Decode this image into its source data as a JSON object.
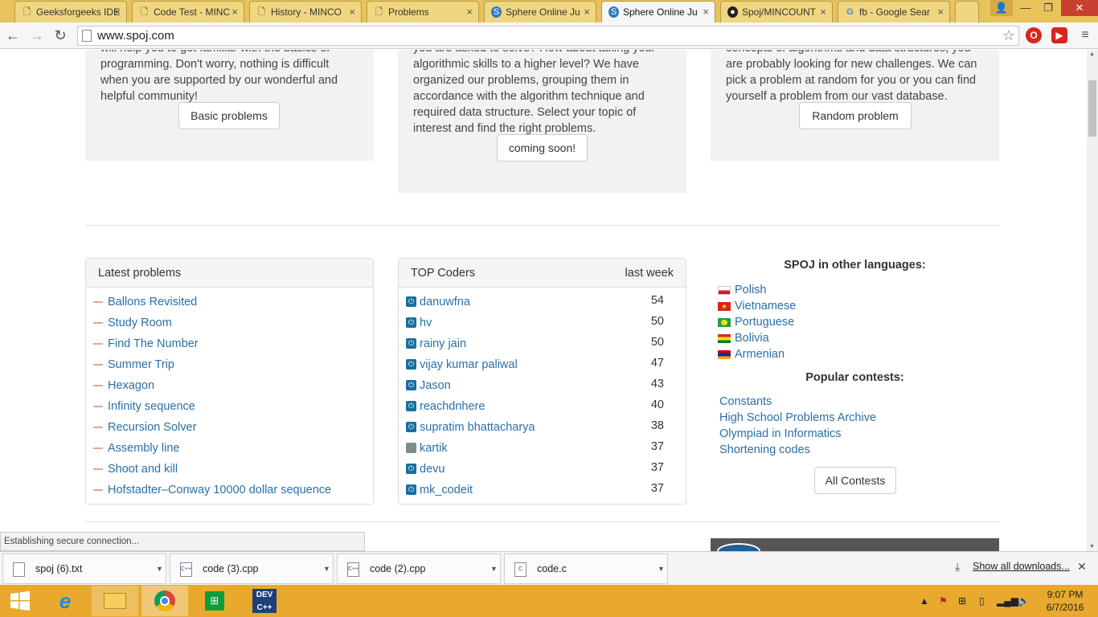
{
  "browser": {
    "tabs": [
      {
        "title": "Geeksforgeeks IDE",
        "icon": "page-icon",
        "active": false
      },
      {
        "title": "Code Test - MINC",
        "icon": "page-icon",
        "active": false
      },
      {
        "title": "History - MINCO",
        "icon": "page-icon",
        "active": false
      },
      {
        "title": "Problems",
        "icon": "page-icon",
        "active": false
      },
      {
        "title": "Sphere Online Ju",
        "icon": "spoj-icon",
        "active": false
      },
      {
        "title": "Sphere Online Ju",
        "icon": "spoj-icon",
        "active": true
      },
      {
        "title": "Spoj/MINCOUNT",
        "icon": "github-icon",
        "active": false
      },
      {
        "title": "fb - Google Sear",
        "icon": "google-icon",
        "active": false
      }
    ],
    "url": "www.spoj.com",
    "status": "Establishing secure connection..."
  },
  "features": [
    {
      "text": "will help you to get familiar with the basics of programming. Don't worry, nothing is difficult when you are supported by our wonderful and helpful community!",
      "button": "Basic problems"
    },
    {
      "text": "you are asked to solve? How about taking your algorithmic skills to a higher level? We have organized our problems, grouping them in accordance with the algorithm technique and required data structure. Select your topic of interest and find the right problems.",
      "button": "coming soon!"
    },
    {
      "text": "concepts of algorithms and data structures, you are probably looking for new challenges. We can pick a problem at random for you or you can find yourself a problem from our vast database.",
      "button": "Random problem"
    }
  ],
  "latest_problems": {
    "heading": "Latest problems",
    "items": [
      "Ballons Revisited",
      "Study Room",
      "Find The Number",
      "Summer Trip",
      "Hexagon",
      "Infinity sequence",
      "Recursion Solver",
      "Assembly line",
      "Shoot and kill",
      "Hofstadter–Conway 10000 dollar sequence"
    ]
  },
  "top_coders": {
    "heading": "TOP Coders",
    "period": "last week",
    "rows": [
      {
        "name": "danuwfna",
        "score": "54",
        "icon": "power-icon"
      },
      {
        "name": "hv",
        "score": "50",
        "icon": "power-icon"
      },
      {
        "name": "rainy jain",
        "score": "50",
        "icon": "power-icon"
      },
      {
        "name": "vijay kumar paliwal",
        "score": "47",
        "icon": "power-icon"
      },
      {
        "name": "Jason",
        "score": "43",
        "icon": "power-icon"
      },
      {
        "name": "reachdnhere",
        "score": "40",
        "icon": "power-icon"
      },
      {
        "name": "supratim bhattacharya",
        "score": "38",
        "icon": "power-icon"
      },
      {
        "name": "kartik",
        "score": "37",
        "icon": "avatar-photo"
      },
      {
        "name": "devu",
        "score": "37",
        "icon": "power-icon"
      },
      {
        "name": "mk_codeit",
        "score": "37",
        "icon": "power-icon"
      }
    ]
  },
  "languages": {
    "heading": "SPOJ in other languages:",
    "items": [
      {
        "label": "Polish",
        "flag": "poland-flag"
      },
      {
        "label": "Vietnamese",
        "flag": "vietnam-flag"
      },
      {
        "label": "Portuguese",
        "flag": "brazil-flag"
      },
      {
        "label": "Bolivia",
        "flag": "bolivia-flag"
      },
      {
        "label": "Armenian",
        "flag": "armenia-flag"
      }
    ]
  },
  "contests": {
    "heading": "Popular contests:",
    "items": [
      "Constants",
      "High School Problems Archive",
      "Olympiad in Informatics",
      "Shortening codes"
    ],
    "button": "All Contests"
  },
  "downloads": {
    "items": [
      "spoj (6).txt",
      "code (3).cpp",
      "code (2).cpp",
      "code.c"
    ],
    "show_all": "Show all downloads..."
  },
  "taskbar": {
    "time": "9:07 PM",
    "date": "6/7/2016",
    "apps": [
      "start-button",
      "internet-explorer-icon",
      "file-explorer-icon",
      "chrome-icon",
      "store-icon",
      "devcpp-icon"
    ]
  },
  "colors": {
    "link": "#2a6fa8",
    "taskbar": "#e8a92e",
    "tab_strip": "#e8c25a"
  }
}
